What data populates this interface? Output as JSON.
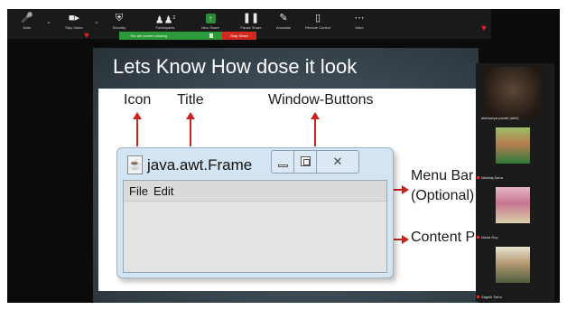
{
  "toolbar": {
    "items": [
      {
        "label": "Mute",
        "icon": "microphone-icon"
      },
      {
        "label": "Stop Video",
        "icon": "video-camera-icon"
      },
      {
        "label": "Security",
        "icon": "shield-icon"
      },
      {
        "label": "Participants",
        "icon": "participants-icon",
        "count": "2"
      },
      {
        "label": "New Share",
        "icon": "share-screen-icon"
      },
      {
        "label": "Pause Share",
        "icon": "pause-icon"
      },
      {
        "label": "Annotate",
        "icon": "pencil-icon"
      },
      {
        "label": "Remote Control",
        "icon": "mouse-icon"
      },
      {
        "label": "More",
        "icon": "more-icon"
      }
    ]
  },
  "recording": {
    "status": "You are screen sharing",
    "stop_label": "Stop Share"
  },
  "slide": {
    "title": "Lets Know How dose it look",
    "annotations": {
      "icon": "Icon",
      "title": "Title",
      "window_buttons": "Window-Buttons",
      "menu_bar": "Menu Bar",
      "optional": "(Optional)",
      "content_pane": "Content P"
    },
    "frame": {
      "title": "java.awt.Frame",
      "menu": [
        "File",
        "Edit"
      ]
    }
  },
  "participants": [
    {
      "name": "aishwarya pande (abhi)"
    },
    {
      "name": "Nishiraj Saha"
    },
    {
      "name": "Nisha Roy"
    },
    {
      "name": "Sagnik Saha"
    }
  ],
  "colors": {
    "arrow": "#c8221b",
    "share_green": "#2a9a3b",
    "stop_red": "#d02a1f",
    "heart": "#e0222a"
  }
}
